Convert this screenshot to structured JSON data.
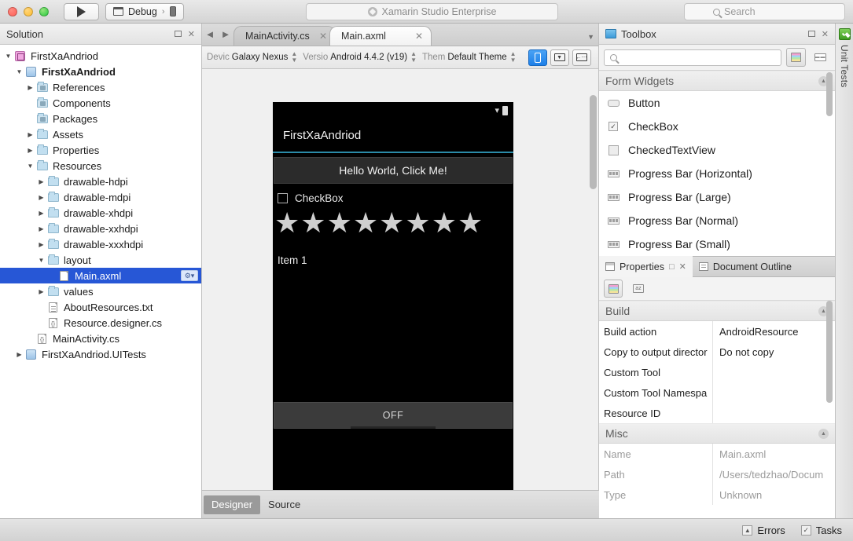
{
  "window": {
    "title": "Xamarin Studio Enterprise",
    "config_label": "Debug",
    "search_placeholder": "Search"
  },
  "solution": {
    "header": "Solution",
    "tree": [
      {
        "label": "FirstXaAndriod",
        "indent": 0,
        "twisty": "▼",
        "icon": "solution-icon",
        "bold": false,
        "selected": false
      },
      {
        "label": "FirstXaAndriod",
        "indent": 1,
        "twisty": "▼",
        "icon": "project-icon",
        "bold": true,
        "selected": false
      },
      {
        "label": "References",
        "indent": 2,
        "twisty": "▶",
        "icon": "references-folder-icon",
        "bold": false,
        "selected": false
      },
      {
        "label": "Components",
        "indent": 2,
        "twisty": "",
        "icon": "references-folder-icon",
        "bold": false,
        "selected": false
      },
      {
        "label": "Packages",
        "indent": 2,
        "twisty": "",
        "icon": "references-folder-icon",
        "bold": false,
        "selected": false
      },
      {
        "label": "Assets",
        "indent": 2,
        "twisty": "▶",
        "icon": "folder-icon",
        "bold": false,
        "selected": false
      },
      {
        "label": "Properties",
        "indent": 2,
        "twisty": "▶",
        "icon": "folder-icon",
        "bold": false,
        "selected": false
      },
      {
        "label": "Resources",
        "indent": 2,
        "twisty": "▼",
        "icon": "folder-icon",
        "bold": false,
        "selected": false
      },
      {
        "label": "drawable-hdpi",
        "indent": 3,
        "twisty": "▶",
        "icon": "folder-icon",
        "bold": false,
        "selected": false
      },
      {
        "label": "drawable-mdpi",
        "indent": 3,
        "twisty": "▶",
        "icon": "folder-icon",
        "bold": false,
        "selected": false
      },
      {
        "label": "drawable-xhdpi",
        "indent": 3,
        "twisty": "▶",
        "icon": "folder-icon",
        "bold": false,
        "selected": false
      },
      {
        "label": "drawable-xxhdpi",
        "indent": 3,
        "twisty": "▶",
        "icon": "folder-icon",
        "bold": false,
        "selected": false
      },
      {
        "label": "drawable-xxxhdpi",
        "indent": 3,
        "twisty": "▶",
        "icon": "folder-icon",
        "bold": false,
        "selected": false
      },
      {
        "label": "layout",
        "indent": 3,
        "twisty": "▼",
        "icon": "folder-icon",
        "bold": false,
        "selected": false
      },
      {
        "label": "Main.axml",
        "indent": 4,
        "twisty": "",
        "icon": "xml-file-icon",
        "bold": false,
        "selected": true
      },
      {
        "label": "values",
        "indent": 3,
        "twisty": "▶",
        "icon": "folder-icon",
        "bold": false,
        "selected": false
      },
      {
        "label": "AboutResources.txt",
        "indent": 3,
        "twisty": "",
        "icon": "text-file-icon",
        "bold": false,
        "selected": false
      },
      {
        "label": "Resource.designer.cs",
        "indent": 3,
        "twisty": "",
        "icon": "csharp-file-icon",
        "bold": false,
        "selected": false
      },
      {
        "label": "MainActivity.cs",
        "indent": 2,
        "twisty": "",
        "icon": "csharp-file-icon",
        "bold": false,
        "selected": false
      },
      {
        "label": "FirstXaAndriod.UITests",
        "indent": 1,
        "twisty": "▶",
        "icon": "project-icon",
        "bold": false,
        "selected": false
      }
    ],
    "gear_label": "⚙▾"
  },
  "editor": {
    "tabs": [
      {
        "label": "MainActivity.cs",
        "active": false
      },
      {
        "label": "Main.axml",
        "active": true
      }
    ],
    "designer_bar": {
      "device_label": "Devic",
      "device_value": "Galaxy Nexus",
      "version_label": "Versio",
      "version_value": "Android 4.4.2 (v19)",
      "theme_label": "Them",
      "theme_value": "Default Theme"
    },
    "float_toolbar": [
      "split-vertical-icon",
      "split-horizontal-icon",
      "fullscreen-icon",
      "zoom-in-icon",
      "zoom-out-icon"
    ],
    "bottom_tabs": [
      {
        "label": "Designer",
        "active": true
      },
      {
        "label": "Source",
        "active": false
      }
    ]
  },
  "preview": {
    "app_title": "FirstXaAndriod",
    "button_text": "Hello World, Click Me!",
    "checkbox_label": "CheckBox",
    "star_count": 8,
    "list_item": "Item 1",
    "switch_label": "OFF"
  },
  "toolbox": {
    "header": "Toolbox",
    "search_placeholder": "",
    "group": "Form Widgets",
    "items": [
      {
        "label": "Button",
        "icon": "button-widget-icon"
      },
      {
        "label": "CheckBox",
        "icon": "checkbox-widget-icon"
      },
      {
        "label": "CheckedTextView",
        "icon": "checkedtextview-widget-icon"
      },
      {
        "label": "Progress Bar (Horizontal)",
        "icon": "progressbar-widget-icon"
      },
      {
        "label": "Progress Bar (Large)",
        "icon": "progressbar-widget-icon"
      },
      {
        "label": "Progress Bar (Normal)",
        "icon": "progressbar-widget-icon"
      },
      {
        "label": "Progress Bar (Small)",
        "icon": "progressbar-widget-icon"
      }
    ]
  },
  "properties": {
    "tabs": [
      {
        "label": "Properties",
        "active": true
      },
      {
        "label": "Document Outline",
        "active": false
      }
    ],
    "groups": [
      {
        "name": "Build",
        "rows": [
          {
            "name": "Build action",
            "value": "AndroidResource",
            "dim": false
          },
          {
            "name": "Copy to output director",
            "value": "Do not copy",
            "dim": false
          },
          {
            "name": "Custom Tool",
            "value": "",
            "dim": false
          },
          {
            "name": "Custom Tool Namespa",
            "value": "",
            "dim": false
          },
          {
            "name": "Resource ID",
            "value": "",
            "dim": false
          }
        ]
      },
      {
        "name": "Misc",
        "rows": [
          {
            "name": "Name",
            "value": "Main.axml",
            "dim": true
          },
          {
            "name": "Path",
            "value": "/Users/tedzhao/Docum",
            "dim": true
          },
          {
            "name": "Type",
            "value": "Unknown",
            "dim": true
          }
        ]
      }
    ]
  },
  "vstrip": {
    "label": "Unit Tests"
  },
  "statusbar": {
    "errors": "Errors",
    "tasks": "Tasks"
  }
}
